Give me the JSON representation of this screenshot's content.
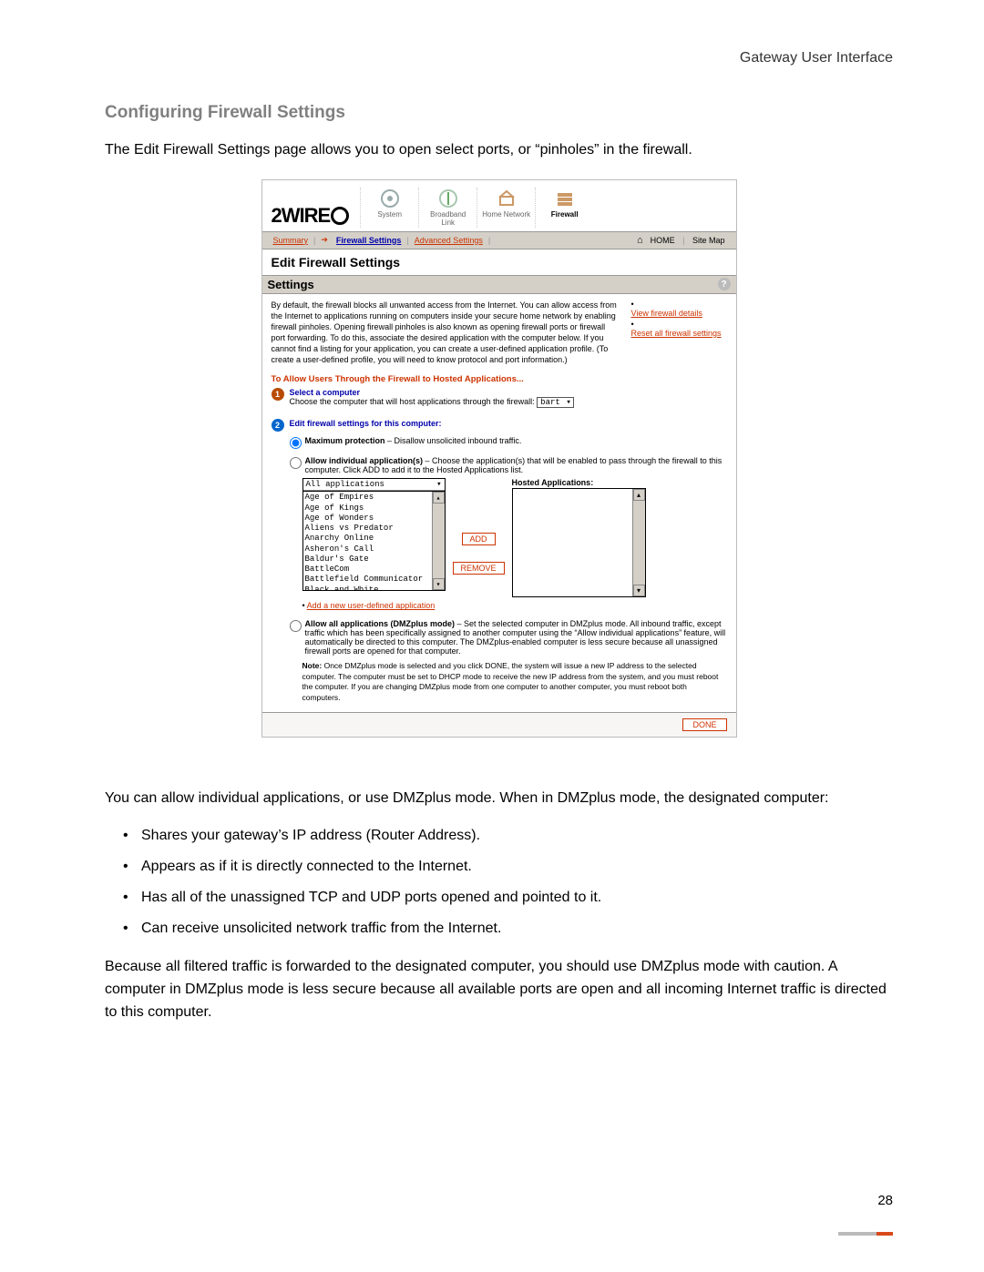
{
  "header": {
    "running": "Gateway User Interface"
  },
  "title": "Configuring Firewall Settings",
  "intro": "The Edit Firewall Settings page allows you to open select ports, or “pinholes” in the firewall.",
  "ui": {
    "logo_text": "2WIRE",
    "nav": [
      {
        "label": "System"
      },
      {
        "label": "Broadband Link"
      },
      {
        "label": "Home Network"
      },
      {
        "label": "Firewall"
      }
    ],
    "tabs": {
      "summary": "Summary",
      "firewall": "Firewall Settings",
      "advanced": "Advanced Settings",
      "home": "HOME",
      "sitemap": "Site Map"
    },
    "panel_title": "Edit Firewall Settings",
    "settings_header": "Settings",
    "description": "By default, the firewall blocks all unwanted access from the Internet. You can allow access from the Internet to applications running on computers inside your secure home network by enabling firewall pinholes. Opening firewall pinholes is also known as opening firewall ports or firewall port forwarding. To do this, associate the desired application with the computer below. If you cannot find a listing for your application, you can create a user-defined application profile. (To create a user-defined profile, you will need to know protocol and port information.)",
    "links": {
      "view": "View firewall details",
      "reset": "Reset all firewall settings"
    },
    "allow_head": "To Allow Users Through the Firewall to Hosted Applications...",
    "step1": {
      "title": "Select a computer",
      "text": "Choose the computer that will host applications through the firewall:",
      "value": "bart"
    },
    "step2": {
      "title": "Edit firewall settings for this computer:"
    },
    "opt_max": {
      "label": "Maximum protection",
      "suffix": " – Disallow unsolicited inbound traffic."
    },
    "opt_allow": {
      "label": "Allow individual application(s)",
      "suffix": " – Choose the application(s) that will be enabled to pass through the firewall to this computer. Click ADD to add it to the Hosted Applications list."
    },
    "select_head": "All applications",
    "apps": [
      "Age of Empires",
      "Age of Kings",
      "Age of Wonders",
      "Aliens vs Predator",
      "Anarchy Online",
      "Asheron's Call",
      "Baldur's Gate",
      "BattleCom",
      "Battlefield Communicator",
      "Black and White"
    ],
    "btn_add": "ADD",
    "btn_remove": "REMOVE",
    "hosted_label": "Hosted Applications:",
    "add_link": "Add a new user-defined application",
    "opt_dmz": {
      "label": "Allow all applications (DMZplus mode)",
      "suffix": " – Set the selected computer in DMZplus mode. All inbound traffic, except traffic which has been specifically assigned to another computer using the “Allow individual applications” feature, will automatically be directed to this computer. The DMZplus-enabled computer is less secure because all unassigned firewall ports are opened for that computer."
    },
    "note_label": "Note:",
    "note_text": " Once DMZplus mode is selected and you click DONE, the system will issue a new IP address to the selected computer. The computer must be set to DHCP mode to receive the new IP address from the system, and you must reboot the computer. If you are changing DMZplus mode from one computer to another computer, you must reboot both computers.",
    "done": "DONE"
  },
  "after": {
    "p1": "You can allow individual applications, or use DMZplus mode. When in DMZplus mode, the designated computer:",
    "bullets": [
      "Shares your gateway’s IP address (Router Address).",
      "Appears as if it is directly connected to the Internet.",
      "Has all of the unassigned TCP and UDP ports opened and pointed to it.",
      "Can receive unsolicited network traffic from the Internet."
    ],
    "p2": "Because all filtered traffic is forwarded to the designated computer, you should use DMZplus mode with caution. A computer in DMZplus mode is less secure because all available ports are open and all incoming Internet traffic is directed to this computer."
  },
  "page_number": "28"
}
